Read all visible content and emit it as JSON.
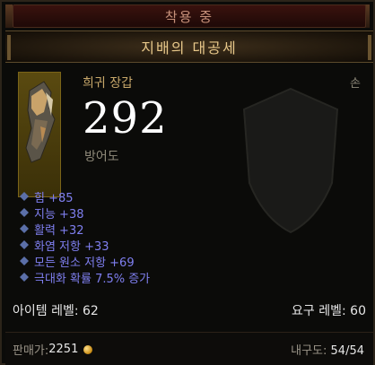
{
  "equipped_tab": "착용 중",
  "item_name": "지배의 대공세",
  "item_type": "희귀 장갑",
  "slot": "손",
  "armor": "292",
  "armor_label": "방어도",
  "stats": [
    "힘 +85",
    "지능 +38",
    "활력 +32",
    "화염 저항 +33",
    "모든 원소 저항 +69",
    "극대화 확률 7.5% 증가"
  ],
  "item_level_label": "아이템 레벨: 62",
  "required_level_label": "요구 레벨: 60",
  "sell_price_label": "판매가: ",
  "sell_price_value": "2251",
  "durability_label": "내구도: ",
  "durability_value": "54/54",
  "colors": {
    "item_name": "#e8c88a",
    "item_type": "#c7a76a",
    "stat": "#7f7ff0",
    "tab_text": "#c7917a"
  },
  "icons": {
    "item": "gauntlet-icon",
    "shield": "shield-icon",
    "bullet": "diamond-bullet-icon",
    "gold": "gold-coin-icon"
  }
}
